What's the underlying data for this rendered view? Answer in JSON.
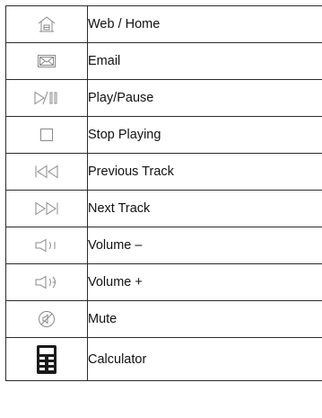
{
  "header": {
    "partial_title": ""
  },
  "rows": [
    {
      "icon": "home-icon",
      "label": "Web / Home"
    },
    {
      "icon": "email-icon",
      "label": "Email"
    },
    {
      "icon": "play-pause-icon",
      "label": "Play/Pause"
    },
    {
      "icon": "stop-icon",
      "label": "Stop Playing"
    },
    {
      "icon": "previous-track-icon",
      "label": "Previous Track"
    },
    {
      "icon": "next-track-icon",
      "label": "Next Track"
    },
    {
      "icon": "volume-down-icon",
      "label": "Volume –"
    },
    {
      "icon": "volume-up-icon",
      "label": "Volume +"
    },
    {
      "icon": "mute-icon",
      "label": "Mute"
    },
    {
      "icon": "calculator-icon",
      "label": "Calculator"
    }
  ]
}
